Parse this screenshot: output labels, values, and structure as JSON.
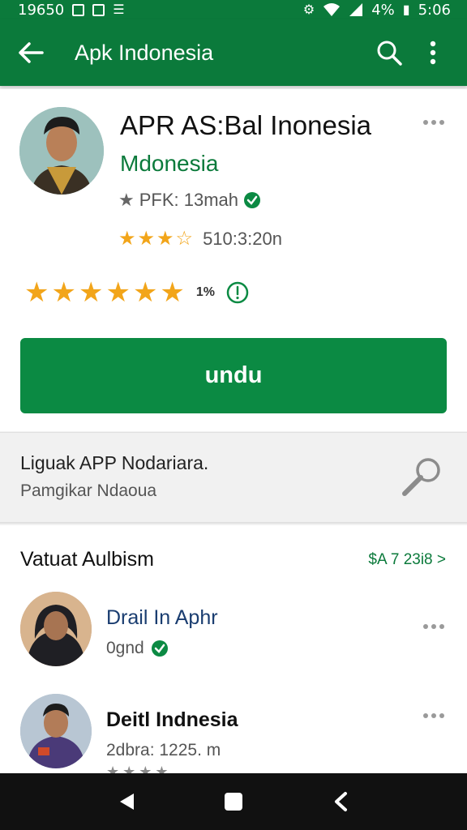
{
  "status_bar": {
    "left_text": "19650",
    "battery_text": "4%",
    "time": "5:06"
  },
  "app_bar": {
    "title": "Apk Indonesia",
    "icons": [
      "back-arrow-icon",
      "search-icon",
      "more-vert-icon"
    ]
  },
  "app_header": {
    "name": "APR AS:Bal Inonesia",
    "developer": "Mdonesia",
    "meta": "PFK: 13mah",
    "rating": {
      "stars_filled": 3.5,
      "stars_total": 5,
      "text": "510:3:20n"
    },
    "big_rating": {
      "stars_filled": 6,
      "stars_total": 6,
      "percent": "1%"
    },
    "install_label": "undu",
    "colors": {
      "primary": "#0b7a3b",
      "button": "#0b8a43",
      "star": "#f2a51a"
    }
  },
  "search_panel": {
    "title": "Liguak APP Nodariara.",
    "subtitle": "Pamgikar Ndaoua"
  },
  "list_section": {
    "title": "Vatuat Aulbism",
    "see_all": "$A 7 23i8 >",
    "items": [
      {
        "title": "Drail In Aphr",
        "subtitle": "0gnd",
        "verified": true
      },
      {
        "title": "Deitl Indnesia",
        "subtitle": "2dbra: 1225. m",
        "verified": false
      }
    ]
  },
  "nav_bar": {
    "buttons": [
      "back-triangle-icon",
      "home-square-icon",
      "recents-chevron-icon"
    ]
  }
}
